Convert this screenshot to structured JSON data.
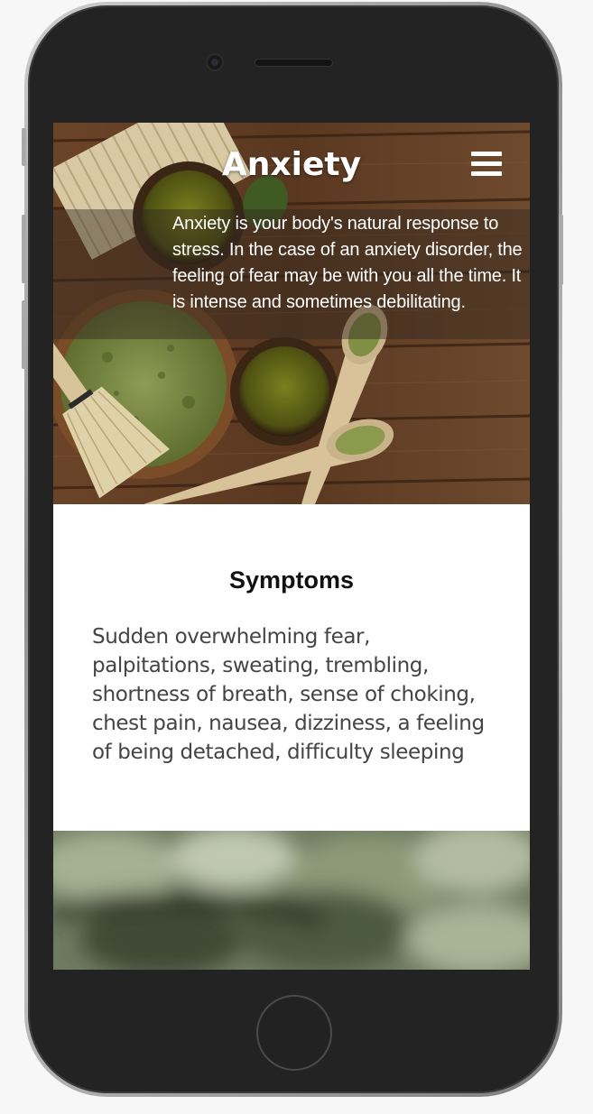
{
  "hero": {
    "title": "Anxiety",
    "intro": "Anxiety is your body's natural response to stress. In the case of an anxiety disorder, the feeling of fear may be with you all the time. It is intense and sometimes debilitating."
  },
  "symptoms": {
    "title": "Symptoms",
    "body": "Sudden overwhelming fear, palpitations, sweating, trembling, shortness of breath, sense of choking, chest pain, nausea, dizziness, a feeling of being detached, difficulty sleeping"
  },
  "icons": {
    "menu": "hamburger-menu-icon",
    "camera": "camera-icon",
    "home": "home-button-icon"
  },
  "colors": {
    "text_white": "#ffffff",
    "body_text": "#444444",
    "phone_body": "#232323",
    "wood": "#5a3a22",
    "matcha": "#6f7f3a"
  }
}
